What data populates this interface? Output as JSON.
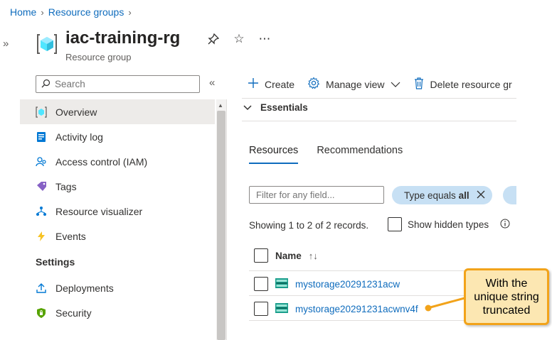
{
  "breadcrumb": {
    "home": "Home",
    "resource_groups": "Resource groups"
  },
  "header": {
    "title": "iac-training-rg",
    "subtitle": "Resource group"
  },
  "sidebar": {
    "search_placeholder": "Search",
    "items": [
      {
        "label": "Overview",
        "icon": "overview-icon"
      },
      {
        "label": "Activity log",
        "icon": "activity-log-icon"
      },
      {
        "label": "Access control (IAM)",
        "icon": "iam-icon"
      },
      {
        "label": "Tags",
        "icon": "tag-icon"
      },
      {
        "label": "Resource visualizer",
        "icon": "resource-visualizer-icon"
      },
      {
        "label": "Events",
        "icon": "events-icon"
      }
    ],
    "settings_heading": "Settings",
    "settings_items": [
      {
        "label": "Deployments",
        "icon": "deployments-icon"
      },
      {
        "label": "Security",
        "icon": "security-icon"
      }
    ]
  },
  "commandbar": {
    "create": "Create",
    "manage_view": "Manage view",
    "delete": "Delete resource gr"
  },
  "essentials": {
    "label": "Essentials"
  },
  "tabs": {
    "resources": "Resources",
    "recommendations": "Recommendations"
  },
  "filter": {
    "placeholder": "Filter for any field...",
    "pill_prefix": "Type equals",
    "pill_value": "all"
  },
  "records": {
    "showing": "Showing 1 to 2 of 2 records.",
    "show_hidden": "Show hidden types"
  },
  "table": {
    "name_header": "Name",
    "rows": [
      {
        "name": "mystorage20291231acw"
      },
      {
        "name": "mystorage20291231acwnv4f"
      }
    ]
  },
  "callout": {
    "text": "With the unique string truncated"
  },
  "colors": {
    "accent": "#0f6cbd",
    "callout_fill": "#fce7b2",
    "callout_border": "#f2a31a",
    "pill": "#c7e0f4"
  }
}
